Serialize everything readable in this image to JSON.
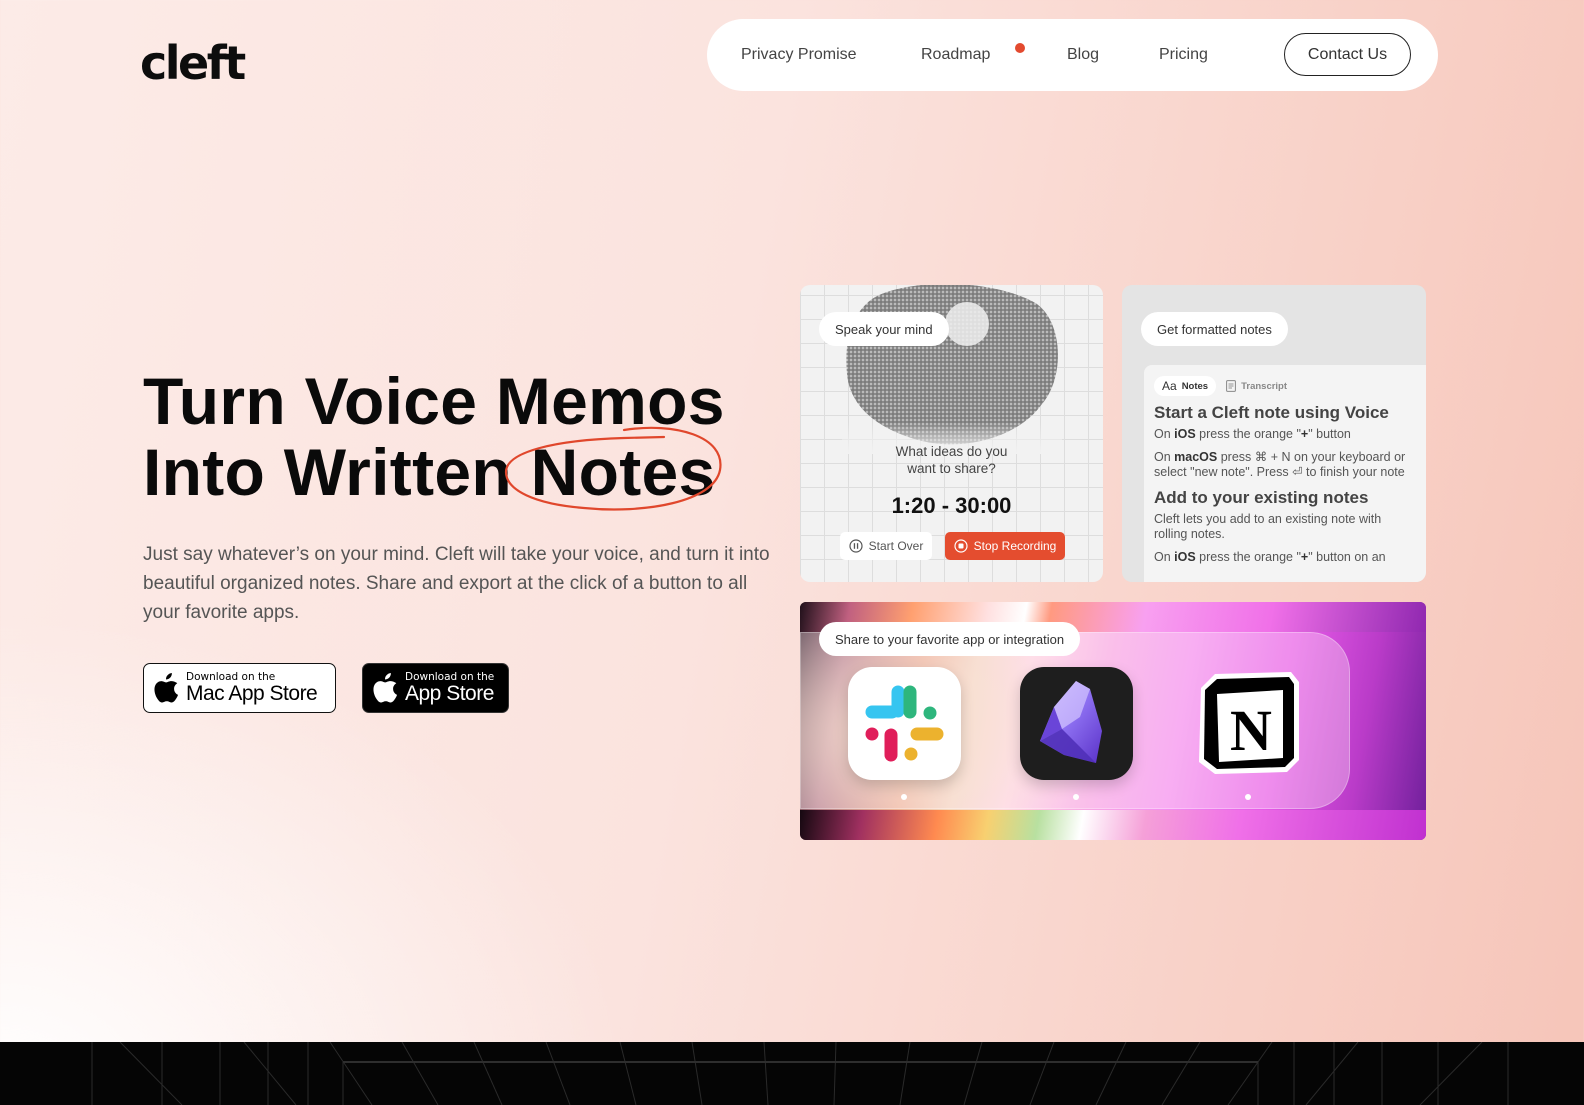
{
  "brand": {
    "logo_text": "cleft",
    "accent_color": "#e34a2f"
  },
  "nav": {
    "links": [
      {
        "label": "Privacy Promise"
      },
      {
        "label": "Roadmap",
        "has_notification_dot": true
      },
      {
        "label": "Blog"
      },
      {
        "label": "Pricing"
      }
    ],
    "contact_label": "Contact Us"
  },
  "hero": {
    "headline_line1": "Turn Voice Memos",
    "headline_line2_prefix": "Into Written ",
    "headline_line2_circled": "Notes",
    "subtext": "Just say whatever’s on your mind. Cleft will take your voice, and turn it into beautiful organized notes. Share and export at the click of a button to all your favorite apps.",
    "store_buttons": [
      {
        "small": "Download on the",
        "big": "Mac App Store",
        "style": "light"
      },
      {
        "small": "Download on the",
        "big": "App Store",
        "style": "dark"
      }
    ]
  },
  "cards": {
    "record": {
      "pill": "Speak your mind",
      "prompt_line1": "What ideas do you",
      "prompt_line2": "want to share?",
      "timer": "1:20 - 30:00",
      "start_over_label": "Start Over",
      "stop_label": "Stop Recording"
    },
    "notes": {
      "pill": "Get formatted notes",
      "tab_notes_icon": "Aa",
      "tab_notes": "Notes",
      "tab_transcript": "Transcript",
      "heading1": "Start a Cleft note using Voice",
      "p1_prefix": "On ",
      "p1_bold": "iOS",
      "p1_suffix": " press the orange \"",
      "p1_plus": "+",
      "p1_end": "\" button",
      "p2_prefix": "On ",
      "p2_bold": "macOS",
      "p2_line1": " press ⌘ + N on your keyboard or",
      "p2_line2": "select \"new note\". Press ⏎ to finish your note",
      "heading2": "Add to your existing notes",
      "p3_line1": "Cleft lets you add to an existing note with",
      "p3_line2": "rolling notes.",
      "p4_prefix": "On ",
      "p4_bold": "iOS",
      "p4_suffix": " press the orange \"",
      "p4_plus": "+",
      "p4_end": "\" button on an"
    },
    "share": {
      "pill": "Share to your favorite app or integration",
      "apps": [
        "Slack",
        "Obsidian",
        "Notion"
      ]
    }
  }
}
